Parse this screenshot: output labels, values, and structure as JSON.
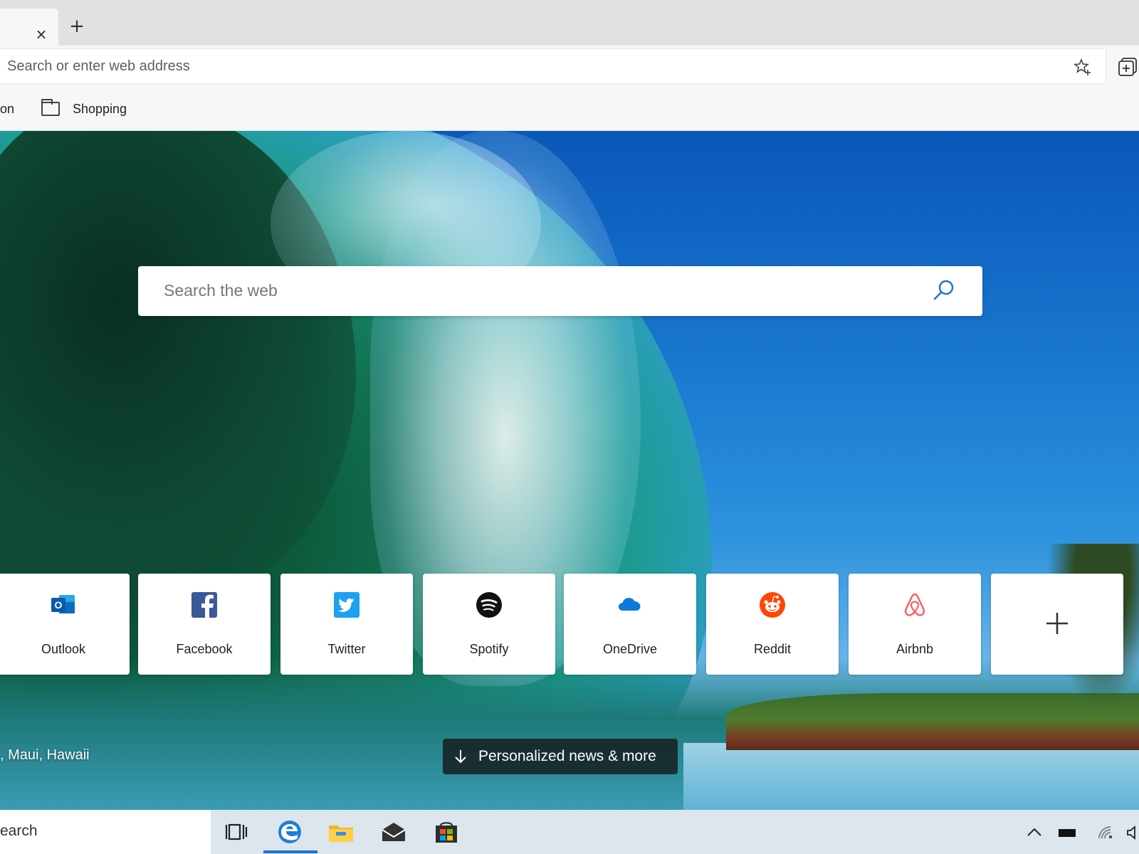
{
  "tabs": {
    "close_glyph": "×",
    "new_tab_glyph": "+"
  },
  "address_bar": {
    "placeholder": "Search or enter web address",
    "favorite_icon": "star-add-icon",
    "collections_icon": "collections-icon"
  },
  "bookmarks": {
    "items": [
      {
        "label": "on"
      },
      {
        "label": "Shopping",
        "icon": "folder-icon"
      }
    ]
  },
  "search": {
    "placeholder": "Search the web",
    "icon": "search-icon",
    "accent": "#1a73d9"
  },
  "quick_links": [
    {
      "label": "Outlook",
      "icon": "outlook-icon",
      "color": "#0f6cbd"
    },
    {
      "label": "Facebook",
      "icon": "facebook-icon",
      "color": "#3b5998"
    },
    {
      "label": "Twitter",
      "icon": "twitter-icon",
      "color": "#1da1f2"
    },
    {
      "label": "Spotify",
      "icon": "spotify-icon",
      "color": "#111111"
    },
    {
      "label": "OneDrive",
      "icon": "onedrive-icon",
      "color": "#0a7bd8"
    },
    {
      "label": "Reddit",
      "icon": "reddit-icon",
      "color": "#ff4500"
    },
    {
      "label": "Airbnb",
      "icon": "airbnb-icon",
      "color": "#ff5a5f"
    },
    {
      "label": "",
      "icon": "add-icon"
    }
  ],
  "background": {
    "location": ", Maui, Hawaii"
  },
  "news_button": {
    "label": "Personalized news & more",
    "icon": "arrow-down-icon"
  },
  "taskbar": {
    "search_text": "earch",
    "apps": [
      {
        "icon": "task-view-icon"
      },
      {
        "icon": "edge-icon",
        "active": true
      },
      {
        "icon": "file-explorer-icon"
      },
      {
        "icon": "mail-icon"
      },
      {
        "icon": "store-icon"
      }
    ],
    "tray": [
      {
        "icon": "chevron-up-icon"
      },
      {
        "icon": "battery-icon"
      },
      {
        "icon": "network-icon"
      },
      {
        "icon": "volume-icon"
      }
    ]
  }
}
